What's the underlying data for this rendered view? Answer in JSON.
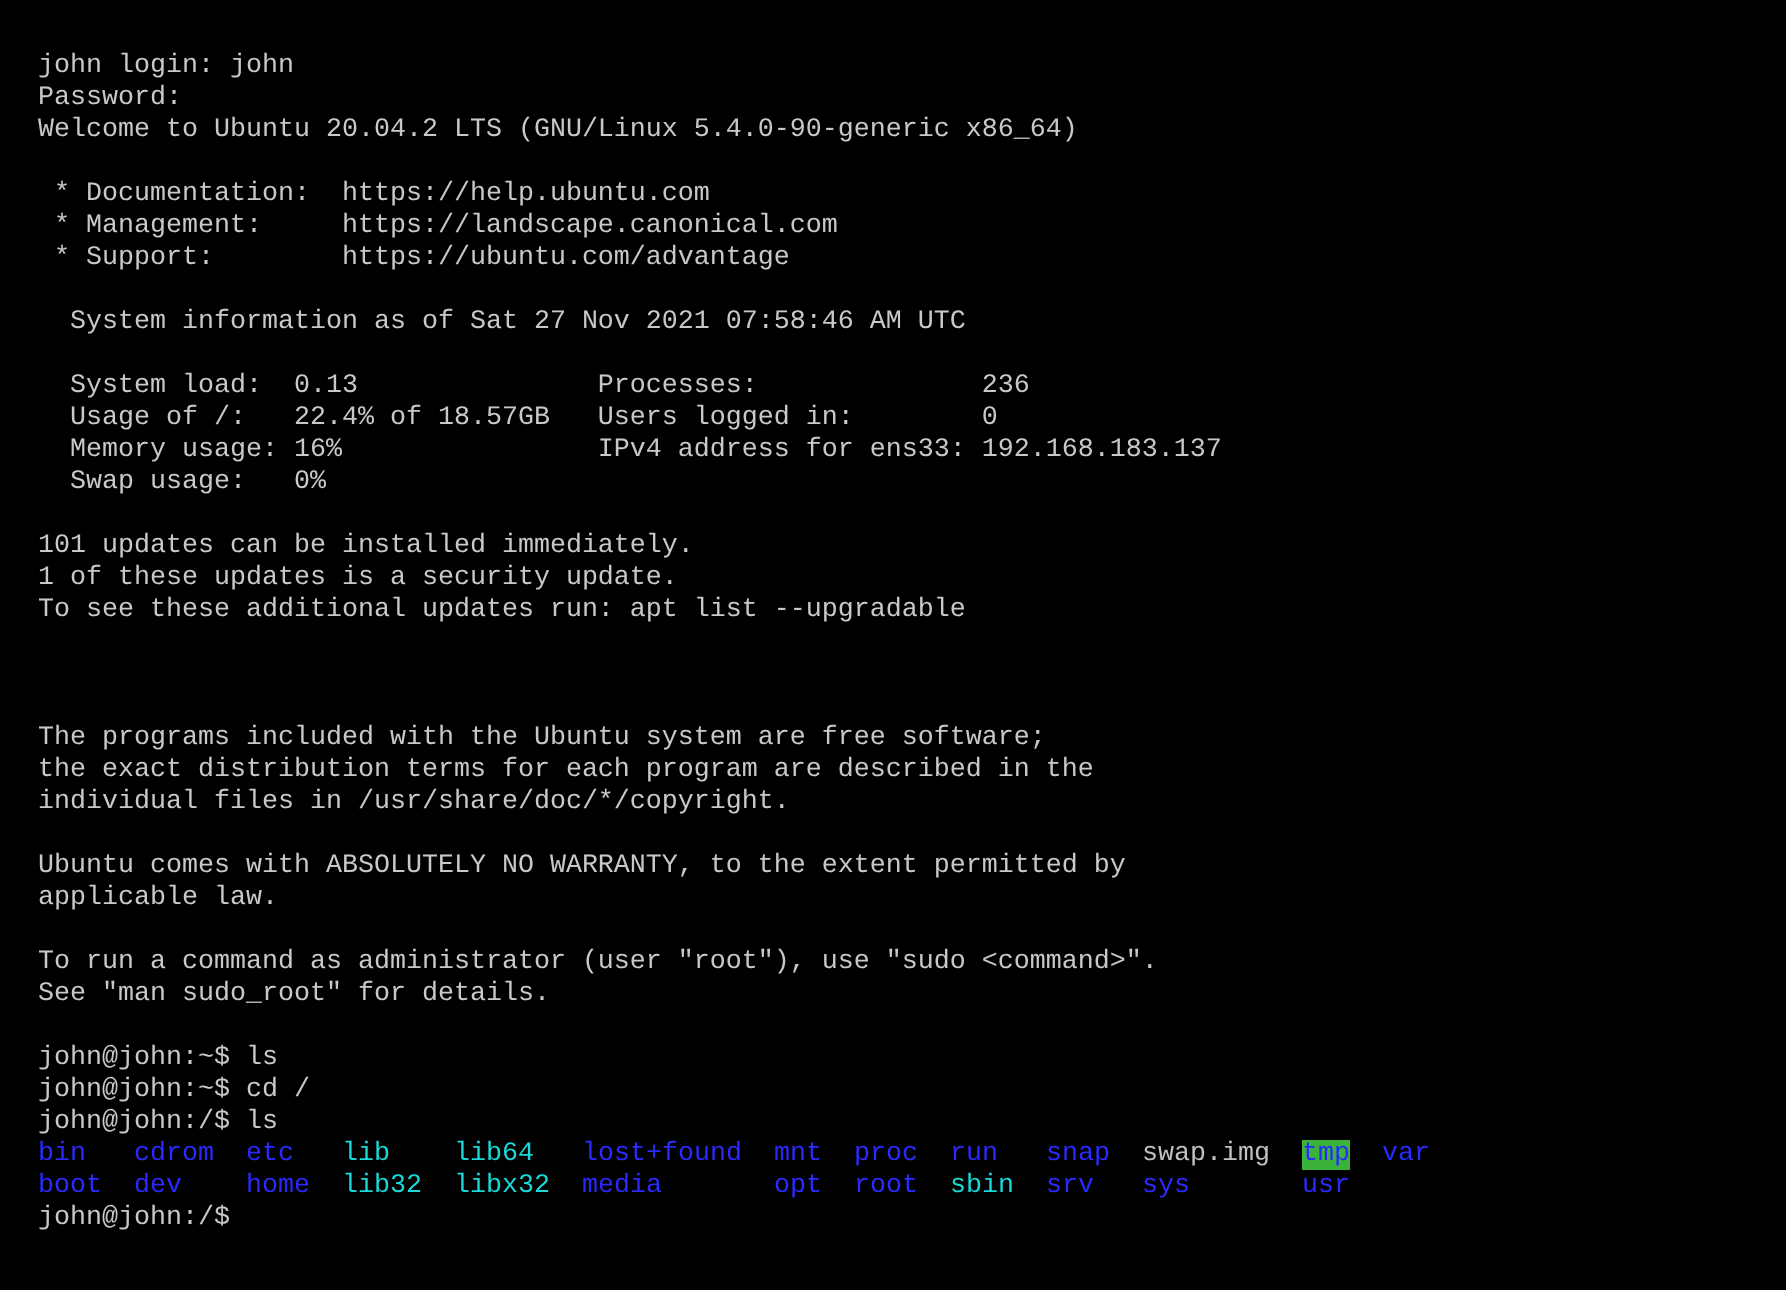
{
  "terminal": {
    "lines": [
      {
        "kind": "text",
        "text": "john login: john"
      },
      {
        "kind": "text",
        "text": "Password:"
      },
      {
        "kind": "text",
        "text": "Welcome to Ubuntu 20.04.2 LTS (GNU/Linux 5.4.0-90-generic x86_64)"
      },
      {
        "kind": "blank"
      },
      {
        "kind": "text",
        "text": " * Documentation:  https://help.ubuntu.com"
      },
      {
        "kind": "text",
        "text": " * Management:     https://landscape.canonical.com"
      },
      {
        "kind": "text",
        "text": " * Support:        https://ubuntu.com/advantage"
      },
      {
        "kind": "blank"
      },
      {
        "kind": "text",
        "text": "  System information as of Sat 27 Nov 2021 07:58:46 AM UTC"
      },
      {
        "kind": "blank"
      },
      {
        "kind": "text",
        "text": "  System load:  0.13               Processes:              236"
      },
      {
        "kind": "text",
        "text": "  Usage of /:   22.4% of 18.57GB   Users logged in:        0"
      },
      {
        "kind": "text",
        "text": "  Memory usage: 16%                IPv4 address for ens33: 192.168.183.137"
      },
      {
        "kind": "text",
        "text": "  Swap usage:   0%"
      },
      {
        "kind": "blank"
      },
      {
        "kind": "text",
        "text": "101 updates can be installed immediately."
      },
      {
        "kind": "text",
        "text": "1 of these updates is a security update."
      },
      {
        "kind": "text",
        "text": "To see these additional updates run: apt list --upgradable"
      },
      {
        "kind": "blank"
      },
      {
        "kind": "blank"
      },
      {
        "kind": "blank"
      },
      {
        "kind": "text",
        "text": "The programs included with the Ubuntu system are free software;"
      },
      {
        "kind": "text",
        "text": "the exact distribution terms for each program are described in the"
      },
      {
        "kind": "text",
        "text": "individual files in /usr/share/doc/*/copyright."
      },
      {
        "kind": "blank"
      },
      {
        "kind": "text",
        "text": "Ubuntu comes with ABSOLUTELY NO WARRANTY, to the extent permitted by"
      },
      {
        "kind": "text",
        "text": "applicable law."
      },
      {
        "kind": "blank"
      },
      {
        "kind": "text",
        "text": "To run a command as administrator (user \"root\"), use \"sudo <command>\"."
      },
      {
        "kind": "text",
        "text": "See \"man sudo_root\" for details."
      },
      {
        "kind": "blank"
      },
      {
        "kind": "text",
        "text": "john@john:~$ ls"
      },
      {
        "kind": "text",
        "text": "john@john:~$ cd /"
      },
      {
        "kind": "text",
        "text": "john@john:/$ ls"
      },
      {
        "kind": "listing",
        "entries": [
          {
            "name": "bin",
            "kind": "dir"
          },
          {
            "name": "boot",
            "kind": "dir"
          },
          {
            "name": "cdrom",
            "kind": "dir"
          },
          {
            "name": "dev",
            "kind": "dir"
          },
          {
            "name": "etc",
            "kind": "dir"
          },
          {
            "name": "home",
            "kind": "dir"
          },
          {
            "name": "lib",
            "kind": "link"
          },
          {
            "name": "lib32",
            "kind": "link"
          },
          {
            "name": "lib64",
            "kind": "link"
          },
          {
            "name": "libx32",
            "kind": "link"
          },
          {
            "name": "lost+found",
            "kind": "dir"
          },
          {
            "name": "media",
            "kind": "dir"
          },
          {
            "name": "mnt",
            "kind": "dir"
          },
          {
            "name": "opt",
            "kind": "dir"
          },
          {
            "name": "proc",
            "kind": "dir"
          },
          {
            "name": "root",
            "kind": "dir"
          },
          {
            "name": "run",
            "kind": "dir"
          },
          {
            "name": "sbin",
            "kind": "link"
          },
          {
            "name": "snap",
            "kind": "dir"
          },
          {
            "name": "srv",
            "kind": "dir"
          },
          {
            "name": "swap.img",
            "kind": "file"
          },
          {
            "name": "sys",
            "kind": "dir"
          },
          {
            "name": "tmp",
            "kind": "sticky"
          },
          {
            "name": "usr",
            "kind": "dir"
          },
          {
            "name": "var",
            "kind": "dir"
          }
        ]
      },
      {
        "kind": "text",
        "text": "john@john:/$"
      }
    ]
  }
}
